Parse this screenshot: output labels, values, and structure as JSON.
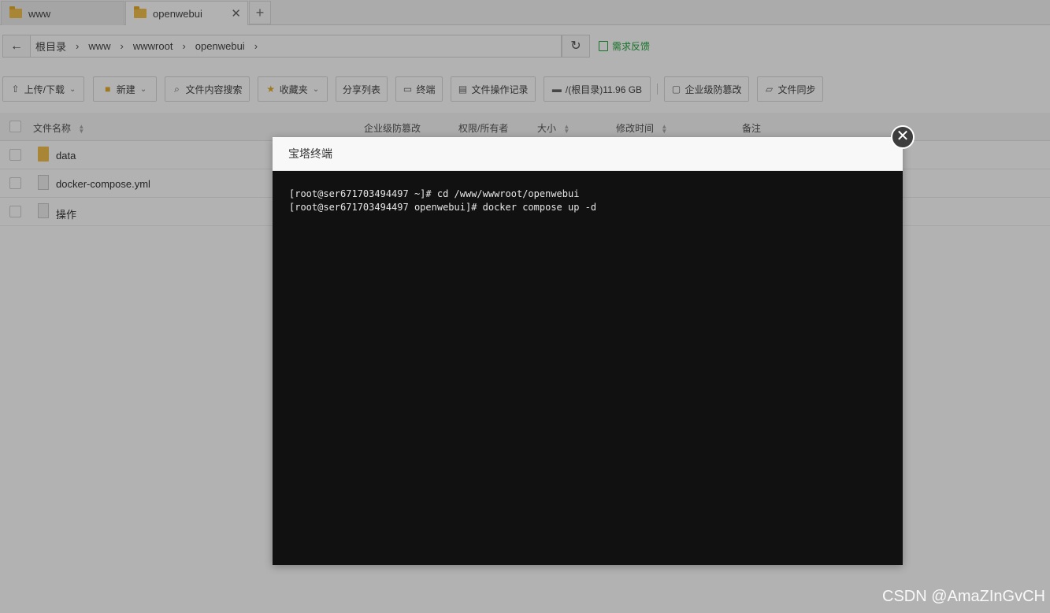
{
  "tabs": [
    {
      "label": "www"
    },
    {
      "label": "openwebui"
    }
  ],
  "tab_close": "✕",
  "tab_add": "+",
  "breadcrumb": [
    "根目录",
    "www",
    "wwwroot",
    "openwebui"
  ],
  "feedback_label": "需求反馈",
  "toolbar": {
    "upload": "上传/下载",
    "new": "新建",
    "search": "文件内容搜索",
    "favorites": "收藏夹",
    "share_list": "分享列表",
    "terminal": "终端",
    "op_log": "文件操作记录",
    "disk": "/(根目录)11.96 GB",
    "tamper": "企业级防篡改",
    "sync": "文件同步"
  },
  "table": {
    "headers": {
      "name": "文件名称",
      "tamper": "企业级防篡改",
      "perm": "权限/所有者",
      "size": "大小",
      "mtime": "修改时间",
      "remark": "备注"
    },
    "rows": [
      {
        "name": "data",
        "type": "folder"
      },
      {
        "name": "docker-compose.yml",
        "type": "file"
      },
      {
        "name": "操作",
        "type": "file"
      }
    ]
  },
  "modal": {
    "title": "宝塔终端",
    "close": "✕",
    "terminal_lines": [
      "[root@ser671703494497 ~]# cd /www/wwwroot/openwebui",
      "[root@ser671703494497 openwebui]# docker compose up -d"
    ]
  },
  "watermark": "CSDN @AmaZInGvCH",
  "colors": {
    "accent_green": "#20a53a",
    "folder_yellow": "#f2c14e",
    "terminal_bg": "#111111"
  }
}
